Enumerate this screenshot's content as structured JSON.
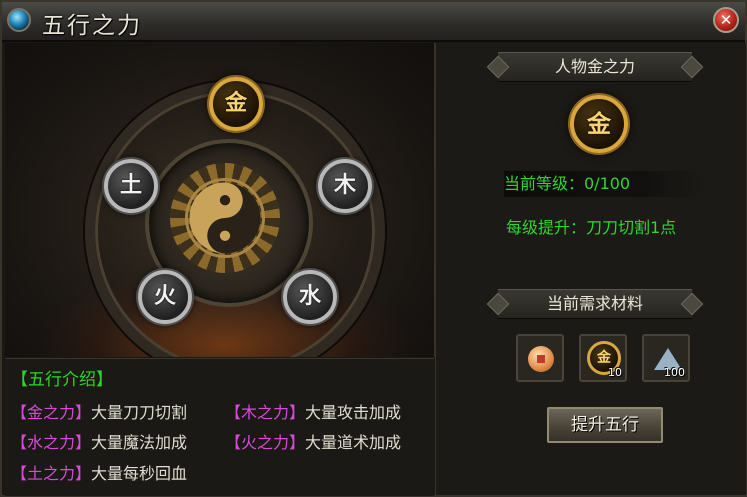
{
  "window": {
    "title": "五行之力",
    "close_label": "✕"
  },
  "elements": {
    "metal": "金",
    "wood": "木",
    "earth": "土",
    "fire": "火",
    "water": "水"
  },
  "intro": {
    "title": "【五行介绍】",
    "rows": [
      {
        "tag": "【金之力】",
        "desc": "大量刀刀切割"
      },
      {
        "tag": "【木之力】",
        "desc": "大量攻击加成"
      },
      {
        "tag": "【水之力】",
        "desc": "大量魔法加成"
      },
      {
        "tag": "【火之力】",
        "desc": "大量道术加成"
      },
      {
        "tag": "【土之力】",
        "desc": "大量每秒回血"
      }
    ]
  },
  "detail": {
    "heading": "人物金之力",
    "icon_char": "金",
    "level_label": "当前等级：0/100",
    "per_level_label": "每级提升：刀刀切割1点",
    "materials_heading": "当前需求材料",
    "materials": [
      {
        "icon": "copper-coin-icon",
        "qty": ""
      },
      {
        "icon": "metal-orb-icon",
        "char": "金",
        "qty": "10"
      },
      {
        "icon": "crystal-shard-icon",
        "qty": "100"
      }
    ],
    "upgrade_label": "提升五行"
  },
  "colors": {
    "green_text": "#2fd62f",
    "magenta_tag": "#d94ad9",
    "gold": "#d9a73e"
  }
}
